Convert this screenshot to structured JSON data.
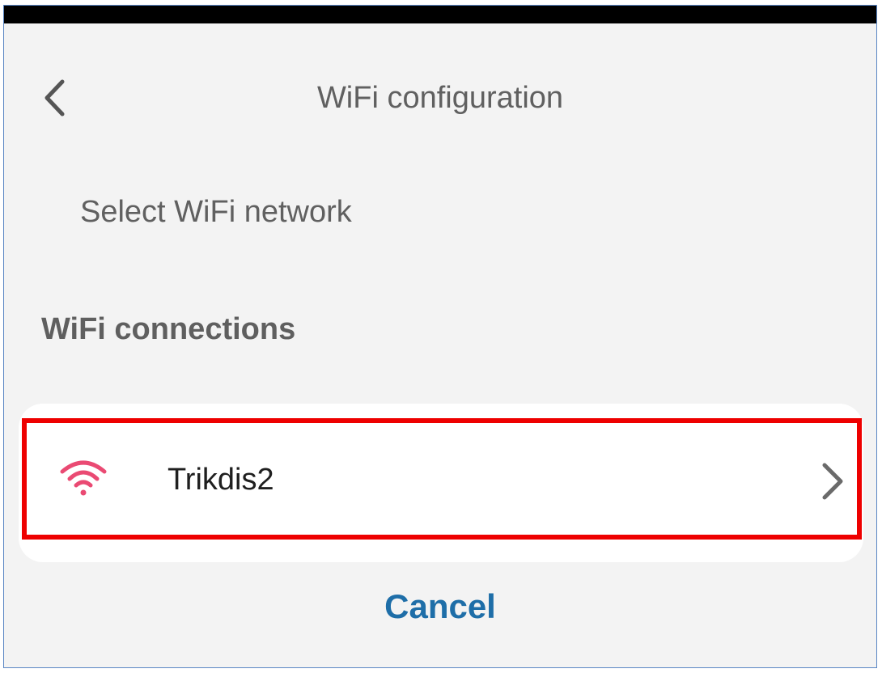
{
  "header": {
    "title": "WiFi configuration",
    "back_icon": "chevron-left-icon"
  },
  "subtitle": "Select WiFi network",
  "section": {
    "heading": "WiFi connections"
  },
  "networks": [
    {
      "name": "Trikdis2",
      "icon": "wifi-icon",
      "icon_color": "#ea4a73",
      "selected": true,
      "arrow_icon": "chevron-right-icon"
    }
  ],
  "actions": {
    "cancel_label": "Cancel"
  },
  "colors": {
    "background": "#f3f3f3",
    "accent": "#1e6ea8",
    "highlight": "#ee0000",
    "wifi": "#ea4a73"
  }
}
